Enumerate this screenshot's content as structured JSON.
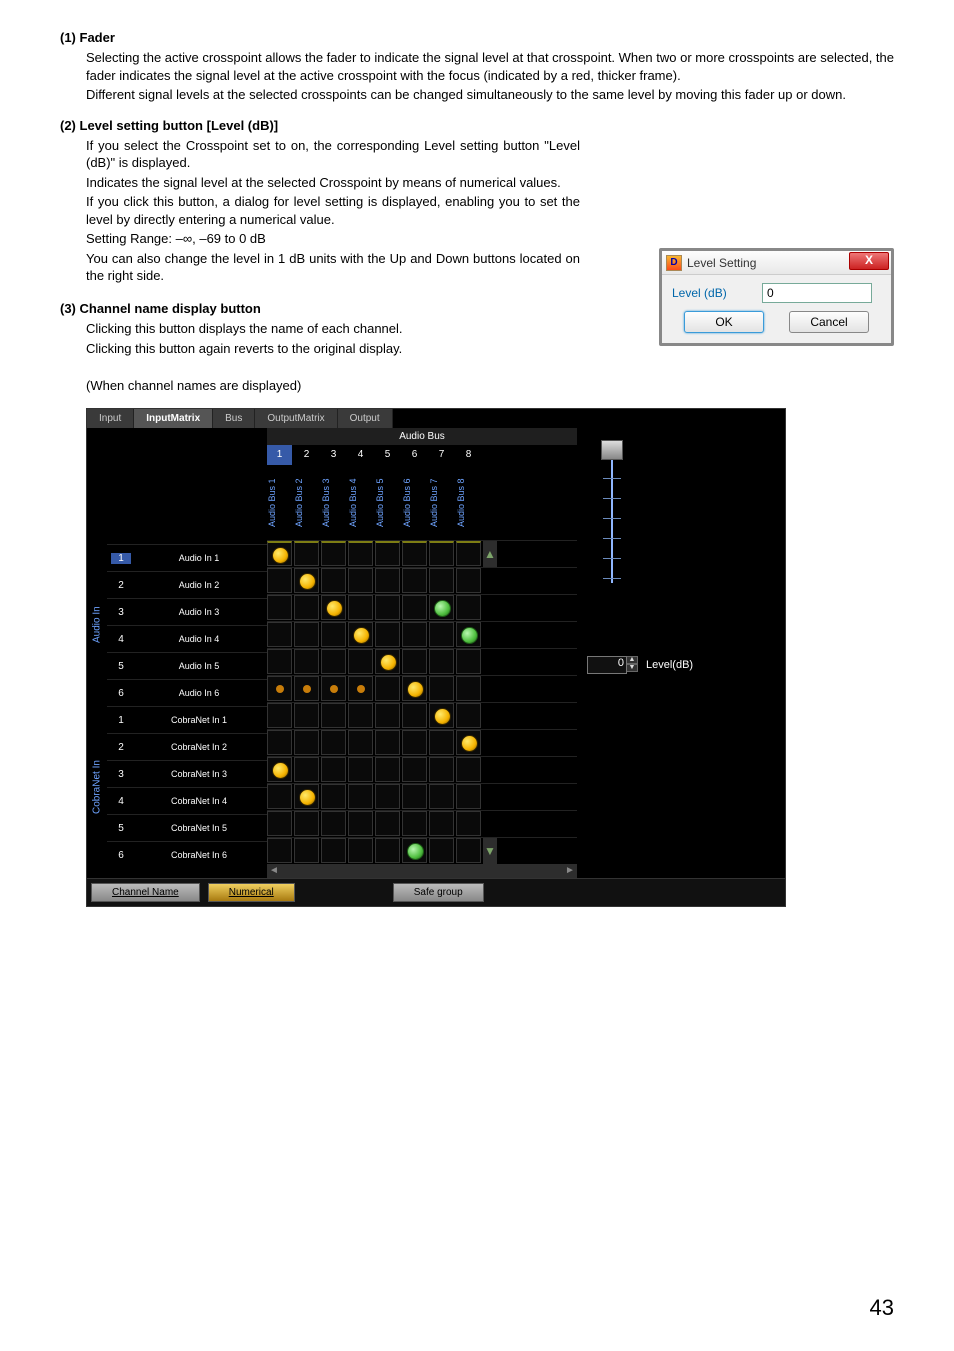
{
  "sections": {
    "fader": {
      "title": "(1) Fader",
      "p1": "Selecting the active crosspoint allows the fader to indicate the signal level at that crosspoint. When two or more crosspoints are selected, the fader indicates the signal level at the active crosspoint with the focus (indicated by a red, thicker frame).",
      "p2": "Different signal levels at the selected crosspoints can be changed simultaneously to the same level by moving this fader up or down."
    },
    "level": {
      "title": "(2) Level setting button [Level (dB)]",
      "p1": "If you select the Crosspoint set to on, the corresponding Level setting button \"Level (dB)\" is displayed.",
      "p2": "Indicates the signal level at the selected Crosspoint by means of numerical values.",
      "p3": "If you click this button, a dialog for level setting is displayed, enabling you to set the level by directly entering a numerical value.",
      "p4": "Setting Range: –∞, –69 to 0 dB",
      "p5": "You can also change the level in 1 dB units with the Up and Down buttons located on the right side."
    },
    "channel": {
      "title": "(3) Channel name display button",
      "p1": "Clicking this button displays the name of each channel.",
      "p2": "Clicking this button again reverts to the original display.",
      "caption": "(When channel names are displayed)"
    }
  },
  "dialog": {
    "title": "Level Setting",
    "label": "Level (dB)",
    "value": "0",
    "ok": "OK",
    "cancel": "Cancel",
    "close": "X"
  },
  "matrix": {
    "tabs": [
      "Input",
      "InputMatrix",
      "Bus",
      "OutputMatrix",
      "Output"
    ],
    "active_tab": 1,
    "bus_header": "Audio Bus",
    "columns": [
      "1",
      "2",
      "3",
      "4",
      "5",
      "6",
      "7",
      "8"
    ],
    "active_col": 0,
    "column_labels": [
      "Audio Bus 1",
      "Audio Bus 2",
      "Audio Bus 3",
      "Audio Bus 4",
      "Audio Bus 5",
      "Audio Bus 6",
      "Audio Bus 7",
      "Audio Bus 8"
    ],
    "groups": [
      {
        "label": "Audio In",
        "rows": [
          {
            "num": "1",
            "name": "Audio In 1",
            "cells": [
              1,
              0,
              0,
              0,
              0,
              0,
              0,
              0
            ],
            "active": true
          },
          {
            "num": "2",
            "name": "Audio In 2",
            "cells": [
              0,
              1,
              0,
              0,
              0,
              0,
              0,
              0
            ]
          },
          {
            "num": "3",
            "name": "Audio In 3",
            "cells": [
              0,
              0,
              1,
              0,
              0,
              0,
              2,
              0
            ]
          },
          {
            "num": "4",
            "name": "Audio In 4",
            "cells": [
              0,
              0,
              0,
              1,
              0,
              0,
              0,
              2
            ]
          },
          {
            "num": "5",
            "name": "Audio In 5",
            "cells": [
              0,
              0,
              0,
              0,
              1,
              0,
              0,
              0
            ]
          },
          {
            "num": "6",
            "name": "Audio In 6",
            "cells": [
              3,
              3,
              3,
              3,
              0,
              1,
              0,
              0
            ]
          }
        ]
      },
      {
        "label": "CobraNet In",
        "rows": [
          {
            "num": "1",
            "name": "CobraNet In 1",
            "cells": [
              0,
              0,
              0,
              0,
              0,
              0,
              1,
              0
            ]
          },
          {
            "num": "2",
            "name": "CobraNet In 2",
            "cells": [
              0,
              0,
              0,
              0,
              0,
              0,
              0,
              1
            ]
          },
          {
            "num": "3",
            "name": "CobraNet In 3",
            "cells": [
              1,
              0,
              0,
              0,
              0,
              0,
              0,
              0
            ]
          },
          {
            "num": "4",
            "name": "CobraNet In 4",
            "cells": [
              0,
              1,
              0,
              0,
              0,
              0,
              0,
              0
            ]
          },
          {
            "num": "5",
            "name": "CobraNet In 5",
            "cells": [
              0,
              0,
              0,
              0,
              0,
              0,
              0,
              0
            ]
          },
          {
            "num": "6",
            "name": "CobraNet In 6",
            "cells": [
              0,
              0,
              0,
              0,
              0,
              2,
              0,
              0
            ]
          }
        ]
      }
    ],
    "level_value": "0",
    "level_label": "Level(dB)",
    "btn_name": "Channel Name",
    "btn_numerical": "Numerical",
    "btn_safe": "Safe group"
  },
  "page_number": "43"
}
